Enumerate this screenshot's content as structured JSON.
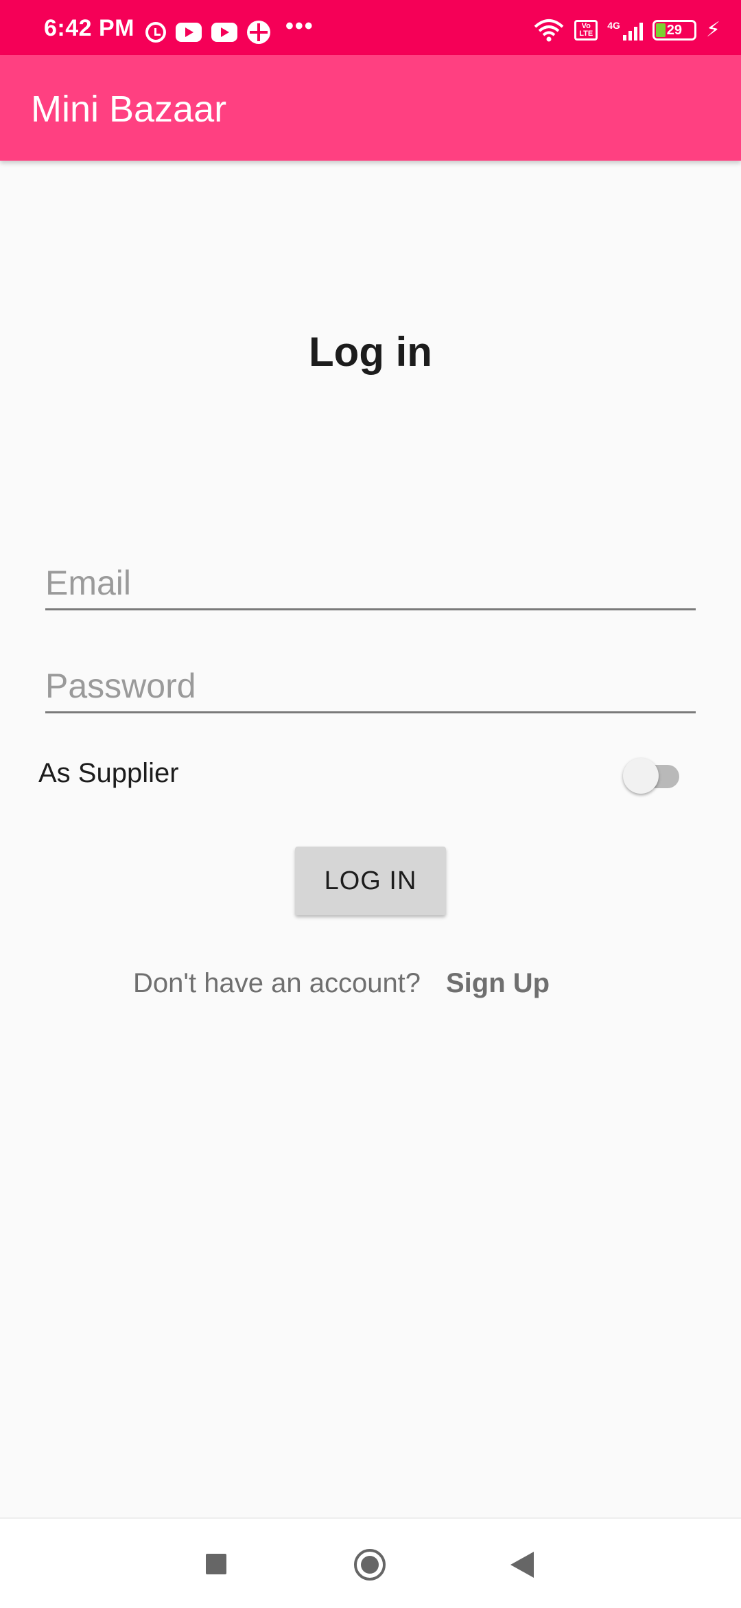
{
  "status_bar": {
    "time": "6:42 PM",
    "left_icons": [
      "alarm-icon",
      "youtube-icon",
      "youtube-icon",
      "flower-app-icon",
      "more-dots-icon"
    ],
    "right_icons": [
      "wifi-icon",
      "volte-icon",
      "signal-4g-icon",
      "battery-icon",
      "charging-icon"
    ],
    "volte_label": "Vo LTE",
    "network_label": "4G",
    "battery_level": "29",
    "colors": {
      "background": "#f50057"
    }
  },
  "app_bar": {
    "title": "Mini Bazaar",
    "colors": {
      "background": "#ff4081"
    }
  },
  "login_form": {
    "heading": "Log in",
    "email": {
      "placeholder": "Email",
      "value": ""
    },
    "password": {
      "placeholder": "Password",
      "value": ""
    },
    "supplier_toggle": {
      "label": "As Supplier",
      "checked": false
    },
    "login_button_label": "LOG IN",
    "signup_prompt": "Don't have an account?",
    "signup_link": "Sign Up"
  },
  "nav_bar": {
    "icons": [
      "recents-square-icon",
      "home-circle-icon",
      "back-triangle-icon"
    ]
  }
}
